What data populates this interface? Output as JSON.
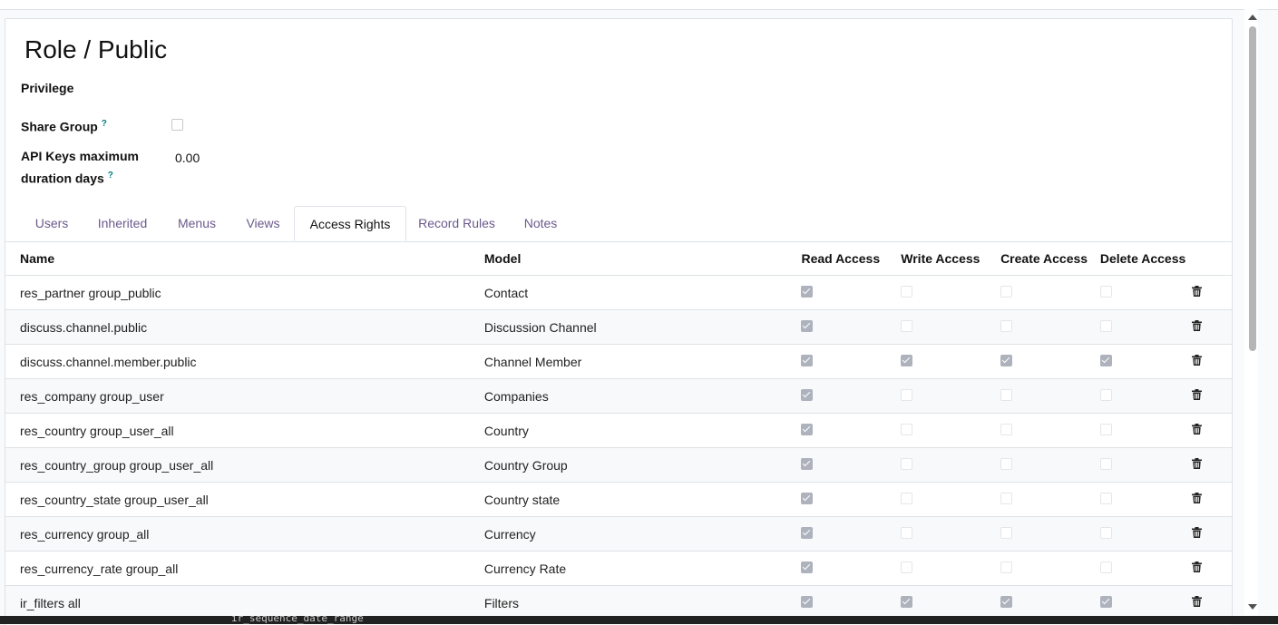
{
  "record": {
    "title": "Role / Public",
    "privilege_label": "Privilege",
    "share_group_label": "Share Group",
    "help_mark": "?",
    "share_group_checked": false,
    "api_keys_label_line1": "API Keys maximum",
    "api_keys_label_line2": "duration days",
    "api_keys_value": "0.00"
  },
  "tabs": [
    {
      "label": "Users",
      "active": false
    },
    {
      "label": "Inherited",
      "active": false
    },
    {
      "label": "Menus",
      "active": false
    },
    {
      "label": "Views",
      "active": false
    },
    {
      "label": "Access Rights",
      "active": true
    },
    {
      "label": "Record Rules",
      "active": false
    },
    {
      "label": "Notes",
      "active": false
    }
  ],
  "table": {
    "columns": [
      "Name",
      "Model",
      "Read Access",
      "Write Access",
      "Create Access",
      "Delete Access"
    ],
    "rows": [
      {
        "name": "res_partner group_public",
        "model": "Contact",
        "read": true,
        "write": false,
        "create": false,
        "delete": false
      },
      {
        "name": "discuss.channel.public",
        "model": "Discussion Channel",
        "read": true,
        "write": false,
        "create": false,
        "delete": false
      },
      {
        "name": "discuss.channel.member.public",
        "model": "Channel Member",
        "read": true,
        "write": true,
        "create": true,
        "delete": true
      },
      {
        "name": "res_company group_user",
        "model": "Companies",
        "read": true,
        "write": false,
        "create": false,
        "delete": false
      },
      {
        "name": "res_country group_user_all",
        "model": "Country",
        "read": true,
        "write": false,
        "create": false,
        "delete": false
      },
      {
        "name": "res_country_group group_user_all",
        "model": "Country Group",
        "read": true,
        "write": false,
        "create": false,
        "delete": false
      },
      {
        "name": "res_country_state group_user_all",
        "model": "Country state",
        "read": true,
        "write": false,
        "create": false,
        "delete": false
      },
      {
        "name": "res_currency group_all",
        "model": "Currency",
        "read": true,
        "write": false,
        "create": false,
        "delete": false
      },
      {
        "name": "res_currency_rate group_all",
        "model": "Currency Rate",
        "read": true,
        "write": false,
        "create": false,
        "delete": false
      },
      {
        "name": "ir_filters all",
        "model": "Filters",
        "read": true,
        "write": true,
        "create": true,
        "delete": true
      }
    ]
  },
  "bottom_bar_text": "ir_sequence_date_range",
  "colors": {
    "tab_link": "#6a5a8c",
    "checked_box": "#aeb2bd",
    "border": "#dee2e6"
  }
}
